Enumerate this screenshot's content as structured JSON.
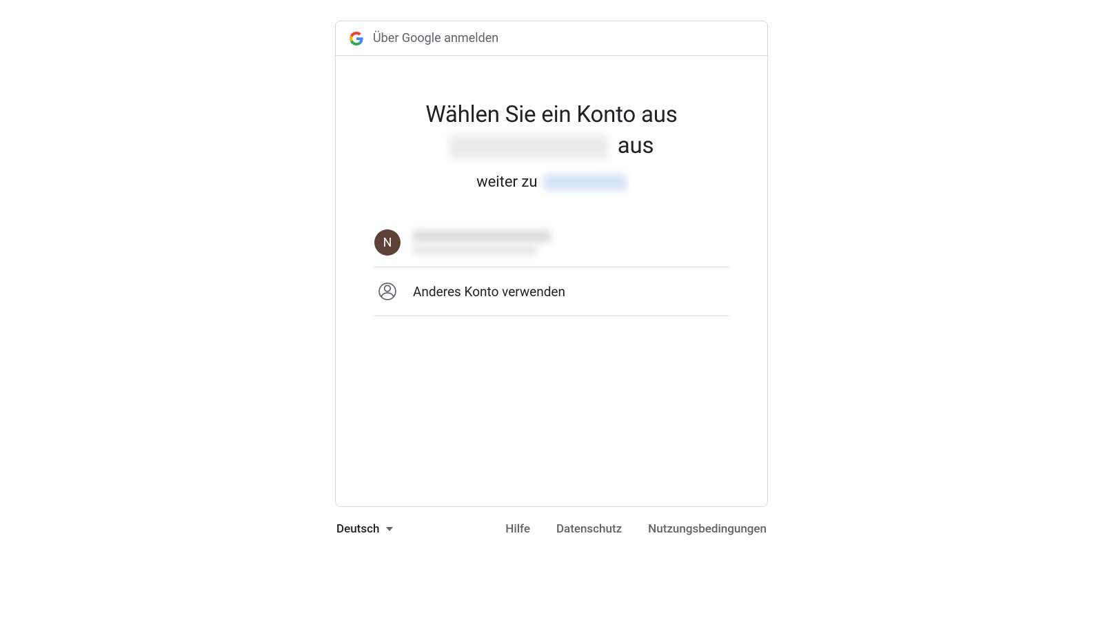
{
  "header": {
    "title": "Über Google anmelden"
  },
  "main": {
    "title_line1": "Wählen Sie ein Konto aus",
    "title_line2_suffix": "aus",
    "subtitle_prefix": "weiter zu"
  },
  "accounts": [
    {
      "avatar_initial": "N"
    }
  ],
  "other_account_label": "Anderes Konto verwenden",
  "footer": {
    "language": "Deutsch",
    "links": {
      "help": "Hilfe",
      "privacy": "Datenschutz",
      "terms": "Nutzungsbedingungen"
    }
  }
}
